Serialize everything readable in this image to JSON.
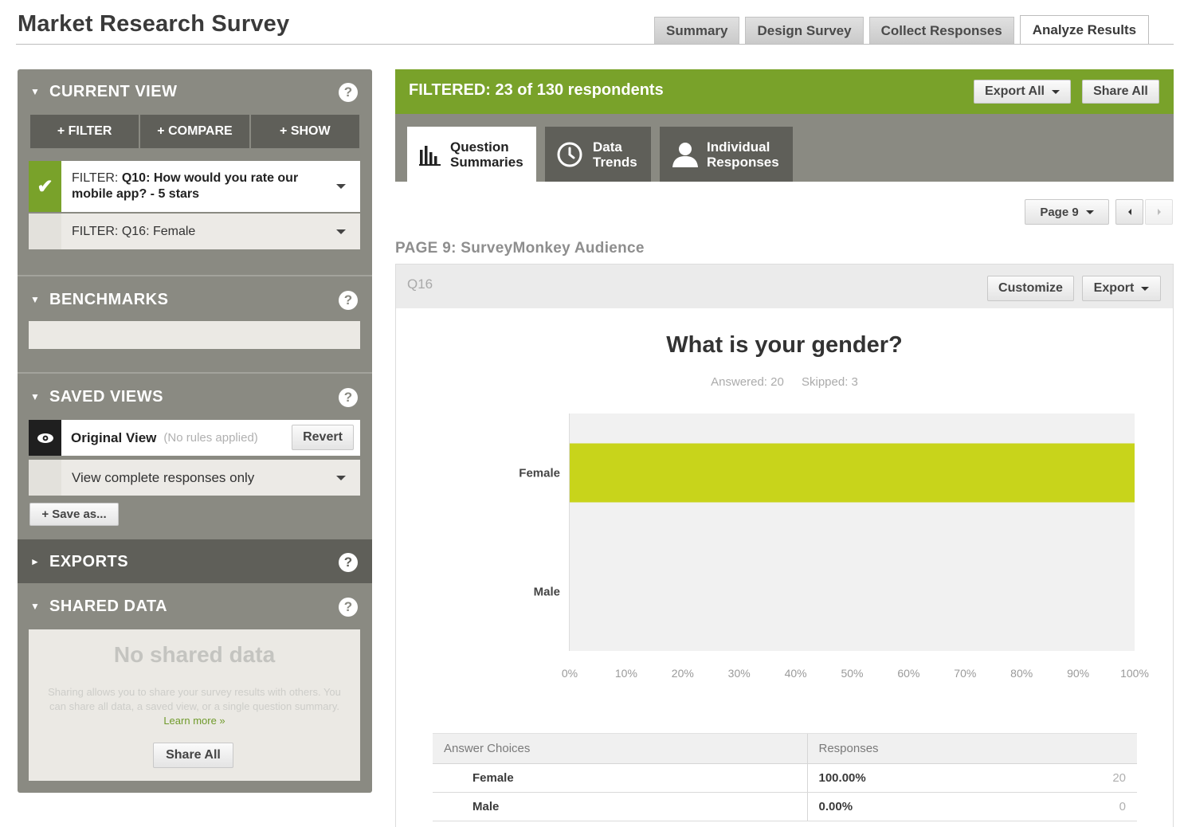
{
  "header": {
    "title": "Market Research Survey",
    "tabs": [
      {
        "label": "Summary",
        "active": false
      },
      {
        "label": "Design Survey",
        "active": false
      },
      {
        "label": "Collect Responses",
        "active": false
      },
      {
        "label": "Analyze Results",
        "active": true
      }
    ]
  },
  "sidebar": {
    "current_view": {
      "heading": "CURRENT VIEW",
      "buttons": [
        "+ FILTER",
        "+ COMPARE",
        "+ SHOW"
      ],
      "filters": [
        {
          "prefix": "FILTER:",
          "text": "Q10: How would you rate our mobile app? - 5 stars",
          "active": true
        },
        {
          "prefix": "FILTER:",
          "text": "Q16: Female",
          "active": false
        }
      ]
    },
    "benchmarks": {
      "heading": "BENCHMARKS"
    },
    "saved_views": {
      "heading": "SAVED VIEWS",
      "original_view_label": "Original View",
      "original_view_note": "(No rules applied)",
      "revert_label": "Revert",
      "dropdown_value": "View complete responses only",
      "save_as_label": "+ Save as..."
    },
    "exports": {
      "heading": "EXPORTS"
    },
    "shared_data": {
      "heading": "SHARED DATA",
      "empty_title": "No shared data",
      "description": "Sharing allows you to share your survey results with others. You can share all data, a saved view, or a single question summary.",
      "learn_more": "Learn more »",
      "share_all_label": "Share All"
    },
    "help_glyph": "?"
  },
  "main": {
    "filtered_text": "FILTERED: 23 of 130 respondents",
    "export_all_label": "Export All",
    "share_all_label": "Share All",
    "view_tabs": [
      {
        "line1": "Question",
        "line2": "Summaries",
        "icon": "bar-chart-icon",
        "active": true
      },
      {
        "line1": "Data",
        "line2": "Trends",
        "icon": "clock-icon",
        "active": false
      },
      {
        "line1": "Individual",
        "line2": "Responses",
        "icon": "person-icon",
        "active": false
      }
    ],
    "page_selector": "Page 9",
    "page_heading": "PAGE 9: SurveyMonkey Audience",
    "question": {
      "id": "Q16",
      "customize_label": "Customize",
      "export_label": "Export",
      "title": "What is your gender?",
      "answered": "Answered: 20",
      "skipped": "Skipped: 3"
    },
    "table": {
      "col_choices": "Answer Choices",
      "col_responses": "Responses",
      "rows": [
        {
          "choice": "Female",
          "percent": "100.00%",
          "count": "20"
        },
        {
          "choice": "Male",
          "percent": "0.00%",
          "count": "0"
        }
      ]
    }
  },
  "colors": {
    "accent_green": "#79a22a",
    "bar_color": "#c8d41b",
    "sidebar_grey": "#8a8a82"
  },
  "chart_data": {
    "type": "bar",
    "orientation": "horizontal",
    "categories": [
      "Female",
      "Male"
    ],
    "values": [
      100,
      0
    ],
    "xlim": [
      0,
      100
    ],
    "x_ticks": [
      "0%",
      "10%",
      "20%",
      "30%",
      "40%",
      "50%",
      "60%",
      "70%",
      "80%",
      "90%",
      "100%"
    ],
    "grid": false
  }
}
